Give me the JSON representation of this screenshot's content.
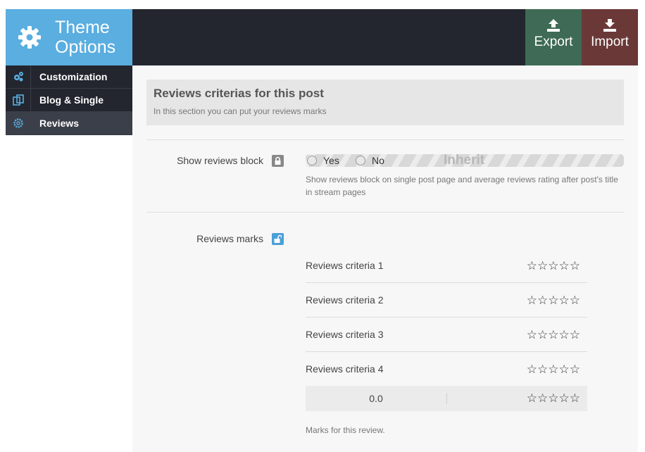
{
  "brand": {
    "title_line1": "Theme",
    "title_line2": "Options",
    "color": "#5aaee0"
  },
  "header": {
    "export_label": "Export",
    "import_label": "Import",
    "export_color": "#3f6a55",
    "import_color": "#6b3838"
  },
  "sidebar": {
    "items": [
      {
        "label": "Customization",
        "icon": "cogs-icon"
      },
      {
        "label": "Blog & Single",
        "icon": "copy-icon"
      },
      {
        "label": "Reviews",
        "icon": "gear-icon",
        "active": true
      }
    ]
  },
  "section": {
    "title": "Reviews criterias for this post",
    "description": "In this section you can put your reviews marks"
  },
  "show_reviews": {
    "label": "Show reviews block",
    "options": [
      "Yes",
      "No",
      "Inherit"
    ],
    "selected": "Inherit",
    "help": "Show reviews block on single post page and average reviews rating after post's title in stream pages"
  },
  "reviews_marks": {
    "label": "Reviews marks",
    "criteria": [
      {
        "name": "Reviews criteria 1",
        "stars": "☆☆☆☆☆"
      },
      {
        "name": "Reviews criteria 2",
        "stars": "☆☆☆☆☆"
      },
      {
        "name": "Reviews criteria 3",
        "stars": "☆☆☆☆☆"
      },
      {
        "name": "Reviews criteria 4",
        "stars": "☆☆☆☆☆"
      }
    ],
    "total_value": "0.0",
    "total_stars": "☆☆☆☆☆",
    "help": "Marks for this review."
  }
}
